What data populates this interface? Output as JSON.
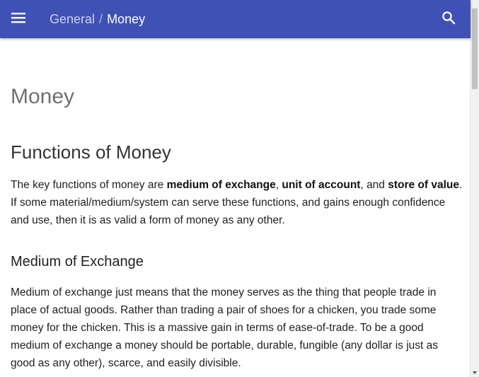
{
  "header": {
    "breadcrumb_parent": "General",
    "breadcrumb_separator": "/",
    "breadcrumb_current": "Money",
    "menu_icon": "menu-icon",
    "search_icon": "search-icon",
    "bar_color": "#3f51b5"
  },
  "article": {
    "title": "Money",
    "section1": {
      "heading": "Functions of Money",
      "p_start": "The key functions of money are ",
      "term1": "medium of exchange",
      "sep1": ", ",
      "term2": "unit of account",
      "sep2": ", and ",
      "term3": "store of value",
      "p_end": ". If some material/medium/system can serve these functions, and gains enough confidence and use, then it is as valid a form of money as any other."
    },
    "section2": {
      "heading": "Medium of Exchange",
      "paragraph": "Medium of exchange just means that the money serves as the thing that people trade in place of actual goods. Rather than trading a pair of shoes for a chicken, you trade some money for the chicken. This is a massive gain in terms of ease-of-trade. To be a good medium of exchange a money should be portable, durable, fungible (any dollar is just as good as any other), scarce, and easily divisible."
    }
  }
}
